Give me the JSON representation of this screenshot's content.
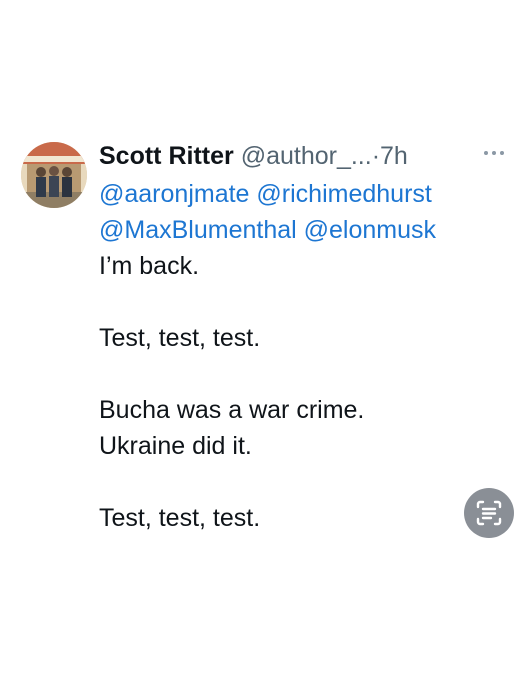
{
  "tweet": {
    "author": {
      "name": "Scott Ritter",
      "handle": "@author_...",
      "separator": "·",
      "time": "7h"
    },
    "more_icon": "more-horizontal-icon",
    "mentions": {
      "line1": [
        "@aaronjmate",
        "@richimedhurst"
      ],
      "line2": [
        "@MaxBlumenthal",
        "@elonmusk"
      ]
    },
    "lines": {
      "back": "I’m back.",
      "test1": "Test, test, test.",
      "bucha": "Bucha was a war crime.",
      "ukraine": "Ukraine did it.",
      "test2": "Test, test, test."
    }
  },
  "overlay": {
    "icon": "live-text-scan-icon"
  },
  "colors": {
    "mention": "#1d76d2",
    "secondary": "#536471",
    "text": "#0f1419",
    "fab": "#8a8f96"
  }
}
